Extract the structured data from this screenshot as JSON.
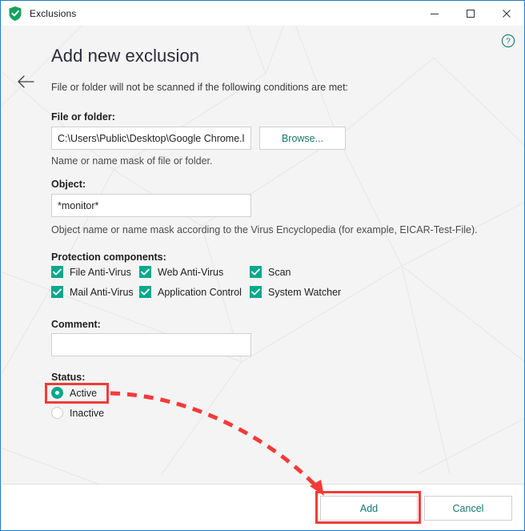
{
  "window": {
    "title": "Exclusions",
    "app_icon": "shield-check-icon",
    "minimize_label": "—",
    "maximize_label": "☐",
    "close_label": "✕"
  },
  "header": {
    "back_icon": "back-arrow-icon",
    "help_icon": "help-circle-icon",
    "page_title": "Add new exclusion",
    "intro": "File or folder will not be scanned if the following conditions are met:"
  },
  "fields": {
    "file_or_folder": {
      "label": "File or folder:",
      "value": "C:\\Users\\Public\\Desktop\\Google Chrome.lnk",
      "placeholder": "",
      "hint": "Name or name mask of file or folder.",
      "browse_label": "Browse..."
    },
    "object": {
      "label": "Object:",
      "value": "*monitor*",
      "placeholder": "",
      "hint": "Object name or name mask according to the Virus Encyclopedia (for example, EICAR-Test-File)."
    },
    "comment": {
      "label": "Comment:",
      "value": "",
      "placeholder": ""
    }
  },
  "protection_components": {
    "label": "Protection components:",
    "items": [
      {
        "label": "File Anti-Virus",
        "checked": true
      },
      {
        "label": "Web Anti-Virus",
        "checked": true
      },
      {
        "label": "Scan",
        "checked": true
      },
      {
        "label": "Mail Anti-Virus",
        "checked": true
      },
      {
        "label": "Application Control",
        "checked": true
      },
      {
        "label": "System Watcher",
        "checked": true
      }
    ]
  },
  "status": {
    "label": "Status:",
    "options": [
      {
        "label": "Active",
        "selected": true
      },
      {
        "label": "Inactive",
        "selected": false
      }
    ]
  },
  "footer": {
    "add_label": "Add",
    "cancel_label": "Cancel"
  },
  "annotations": {
    "highlight_color": "#f23b38",
    "targets": [
      "Active",
      "Add"
    ]
  },
  "colors": {
    "accent": "#0aa88c",
    "link": "#11786e",
    "window_border": "#1f7cc4",
    "content_bg": "#f4f4f4",
    "highlight": "#f23b38"
  }
}
